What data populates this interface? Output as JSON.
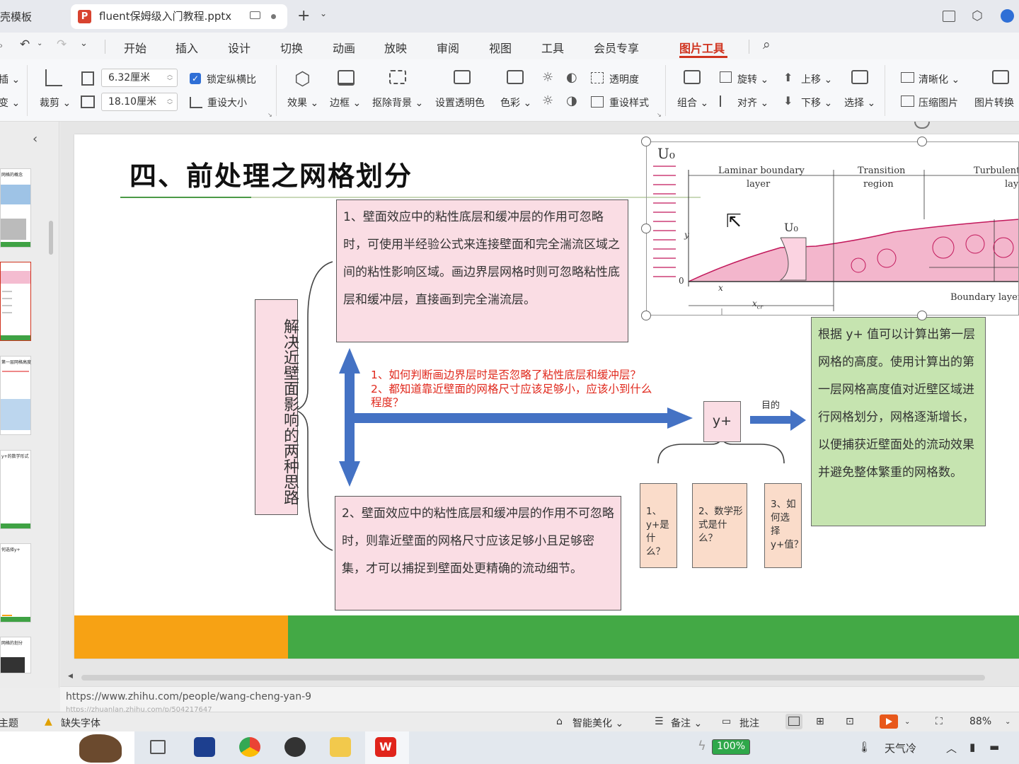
{
  "tabs": {
    "prev_label": "壳模板",
    "active_label": "fluent保姆级入门教程.pptx",
    "ppt_logo": "P",
    "add_symbol": "+"
  },
  "menu": {
    "items": [
      "开始",
      "插入",
      "设计",
      "切换",
      "动画",
      "放映",
      "审阅",
      "视图",
      "工具",
      "会员专享"
    ],
    "active": "图片工具"
  },
  "ribbon": {
    "left_cut_1": "插",
    "left_cut_2": "变",
    "crop": "裁剪",
    "width_value": "6.32厘米",
    "height_value": "18.10厘米",
    "lock_ratio": "锁定纵横比",
    "reset_size": "重设大小",
    "effect": "效果",
    "border": "边框",
    "remove_bg": "抠除背景",
    "set_transparent_color": "设置透明色",
    "color": "色彩",
    "transparency": "透明度",
    "reset_style": "重设样式",
    "group": "组合",
    "rotate": "旋转",
    "align": "对齐",
    "move_up": "上移",
    "move_down": "下移",
    "select": "选择",
    "sharpen": "清晰化",
    "compress": "压缩图片",
    "convert": "图片转换"
  },
  "thumbnails": [
    {
      "title": "网格的概念",
      "num": ""
    },
    {
      "title": "",
      "num": ""
    },
    {
      "title": "第一层网格高度",
      "num": ""
    },
    {
      "title": "y+的数学形式",
      "num": ""
    },
    {
      "title": "何选择y+",
      "num": ""
    },
    {
      "title": "网格的划分",
      "num": ""
    }
  ],
  "slide": {
    "title": "四、前处理之网格划分",
    "vertical_label": "解决近壁面影响的两种思路",
    "box1": "1、壁面效应中的粘性底层和缓冲层的作用可忽略时，可使用半经验公式来连接壁面和完全湍流区域之间的粘性影响区域。画边界层网格时则可忽略粘性底层和缓冲层，直接画到完全湍流层。",
    "box2": "2、壁面效应中的粘性底层和缓冲层的作用不可忽略时，则靠近壁面的网格尺寸应该足够小且足够密集，才可以捕捉到壁面处更精确的流动细节。",
    "red_q1": "1、如何判断画边界层时是否忽略了粘性底层和缓冲层？",
    "red_q2": "2、都知道靠近壁面的网格尺寸应该足够小，应该小到什么程度？",
    "yplus": "y+",
    "purpose": "目的",
    "q1": "1、y+是什么？",
    "q2": "2、数学形式是什么？",
    "q3": "3、如何选择y+值？",
    "green_text": "根据 y+ 值可以计算出第一层网格的高度。使用计算出的第一层网格高度值对近壁区域进行网格划分，网格逐渐增长，以便捕获近壁面处的流动效果并避免整体繁重的网格数。",
    "diagram": {
      "u0": "U₀",
      "u0_inner": "U₀",
      "laminar": "Laminar boundary",
      "laminar2": "layer",
      "transition": "Transition",
      "transition2": "region",
      "turbulent": "Turbulent b",
      "turbulent2": "lay",
      "y_label": "y",
      "zero": "0",
      "x_label": "x",
      "xcr": "x",
      "xcr_sub": "cr",
      "boundary_layer": "Boundary layer t"
    }
  },
  "notes": {
    "url1": "https://www.zhihu.com/people/wang-cheng-yan-9",
    "url2": "https://zhuanlan.zhihu.com/p/504217647"
  },
  "status": {
    "theme": "主题",
    "missing_font": "缺失字体",
    "smart_beautify": "智能美化",
    "notes": "备注",
    "comment": "批注",
    "zoom": "88%"
  },
  "taskbar": {
    "battery": "100%",
    "weather": "天气冷"
  },
  "colors": {
    "accent_red": "#d0331f",
    "slide_orange": "#f7a214",
    "slide_green": "#43a945",
    "pink_box": "#fadde4",
    "green_box": "#c6e4b0",
    "arrow_blue": "#4472c4"
  }
}
